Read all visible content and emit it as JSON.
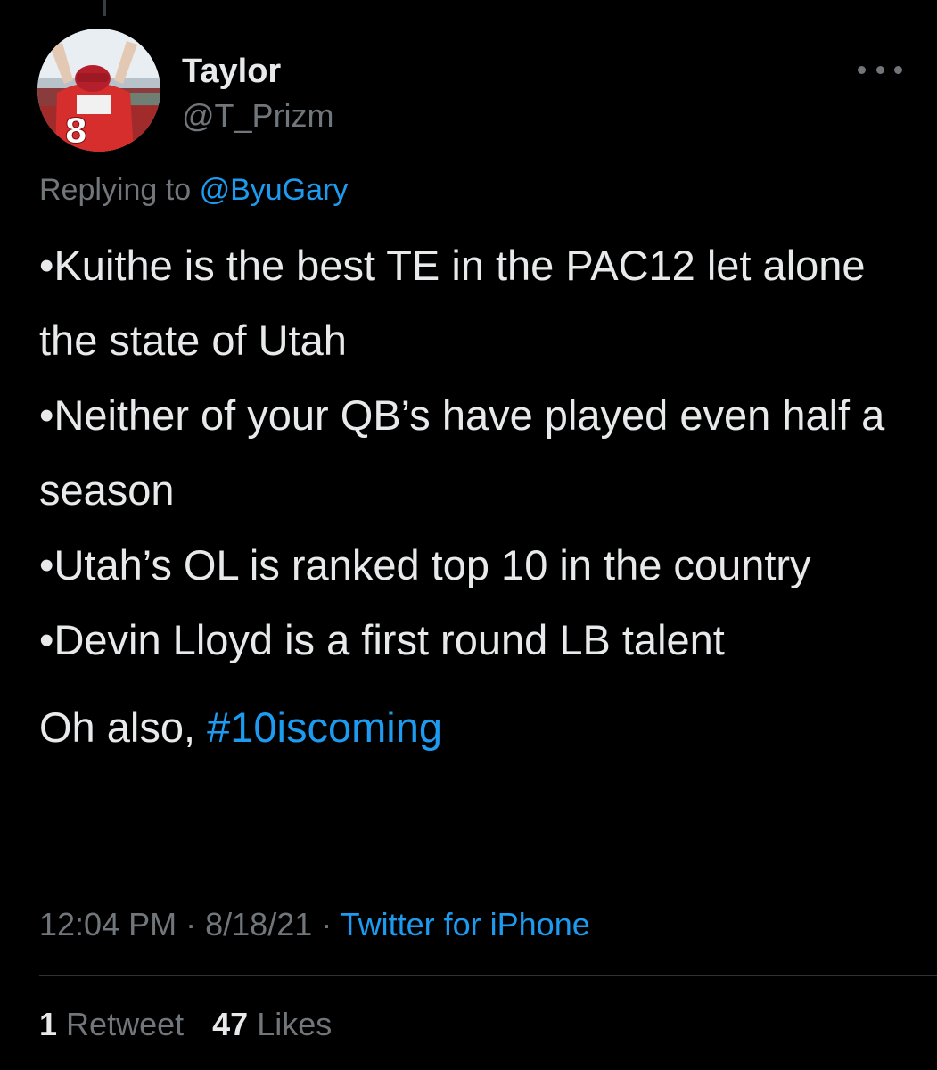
{
  "tweet": {
    "author": {
      "display_name": "Taylor",
      "handle": "@T_Prizm",
      "avatar_jersey_number": "8"
    },
    "reply": {
      "prefix": "Replying to",
      "mention": "@ByuGary"
    },
    "lines": [
      "•Kuithe is the best TE in the PAC12 let alone the state of Utah",
      "•Neither of your QB’s have played even half a season",
      "•Utah’s OL is ranked top 10 in the country",
      "•Devin Lloyd is a first round LB talent"
    ],
    "closing": {
      "text": "Oh also,",
      "hashtag": "#10iscoming"
    },
    "meta": {
      "time": "12:04 PM",
      "separator": "·",
      "date": "8/18/21",
      "source": "Twitter for iPhone"
    },
    "stats": {
      "retweets_count": "1",
      "retweets_label": "Retweet",
      "likes_count": "47",
      "likes_label": "Likes"
    }
  },
  "colors": {
    "background": "#000000",
    "text_primary": "#e7e9ea",
    "text_secondary": "#71767b",
    "accent": "#1d9bf0",
    "divider": "#2f3336"
  },
  "icons": {
    "more": "more-horizontal-icon"
  }
}
